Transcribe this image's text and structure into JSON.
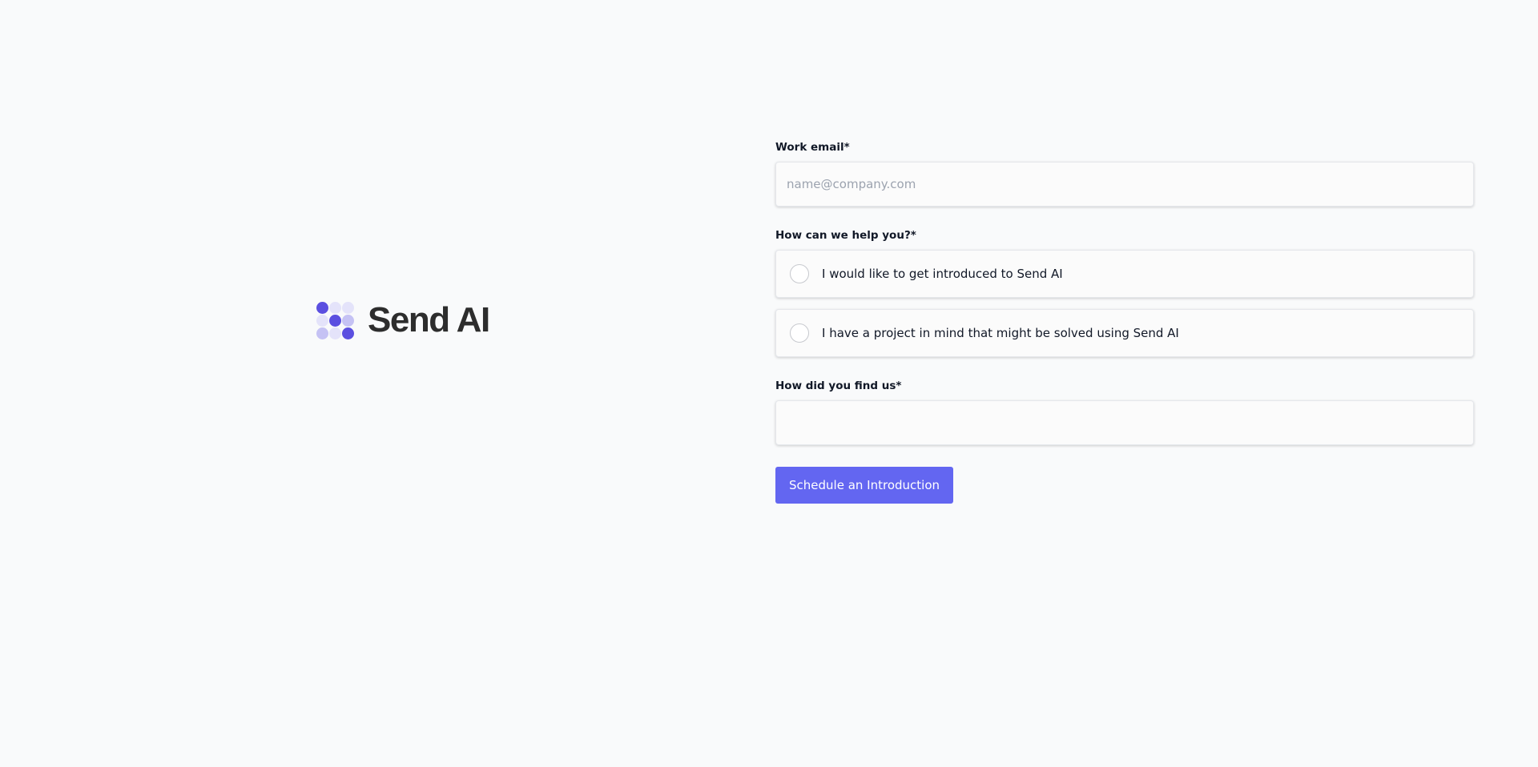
{
  "brand": {
    "name": "Send AI",
    "logo_dot_colors": [
      "#5b4fe0",
      "#e4e3fa",
      "#e4e3fa",
      "#e4e3fa",
      "#5b4fe0",
      "#c5c2f4",
      "#c5c2f4",
      "#e4e3fa",
      "#5b4fe0"
    ]
  },
  "form": {
    "email": {
      "label": "Work email*",
      "placeholder": "name@company.com",
      "value": ""
    },
    "help": {
      "label": "How can we help you?*",
      "options": [
        {
          "label": "I would like to get introduced to Send AI",
          "selected": false
        },
        {
          "label": "I have a project in mind that might be solved using Send AI",
          "selected": false
        }
      ]
    },
    "find": {
      "label": "How did you find us*",
      "value": ""
    },
    "submit_label": "Schedule an Introduction"
  },
  "colors": {
    "background": "#f9fafb",
    "accent": "#6366f1",
    "brand_text": "#2d2d2d"
  }
}
